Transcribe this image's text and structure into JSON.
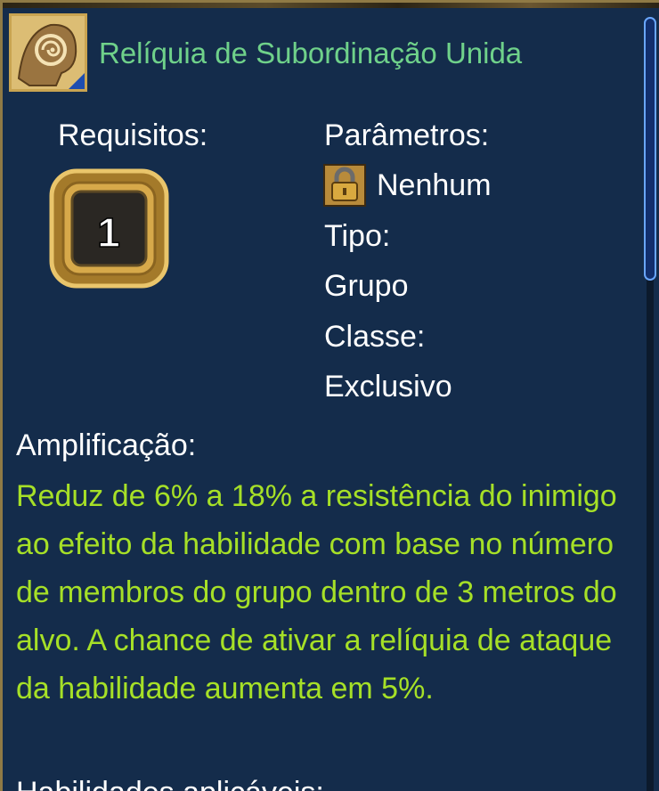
{
  "item": {
    "title": "Relíquia de Subordinação Unida",
    "icon": "relic-spiral-head-icon"
  },
  "requirements": {
    "label": "Requisitos:",
    "level": "1"
  },
  "parameters": {
    "label": "Parâmetros:",
    "value": "Nenhum",
    "icon": "lock-icon"
  },
  "type": {
    "label": "Tipo:",
    "value": "Grupo"
  },
  "class": {
    "label": "Classe:",
    "value": "Exclusivo"
  },
  "amplification": {
    "label": "Amplificação:",
    "text": "Reduz de 6% a 18% a resistência do inimigo ao efeito da habilidade com base no número de membros do grupo dentro de 3 metros do alvo. A chance de ativar a relíquia de ataque da habilidade aumenta em 5%."
  },
  "next_section": {
    "label": "Habilidades aplicáveis:"
  },
  "colors": {
    "panel_bg": "#142c4b",
    "title": "#6fd18a",
    "description": "#a6e027",
    "label": "#ffffff",
    "gold_frame": "#c9a451",
    "scroll_thumb_border": "#6aa7ff"
  }
}
